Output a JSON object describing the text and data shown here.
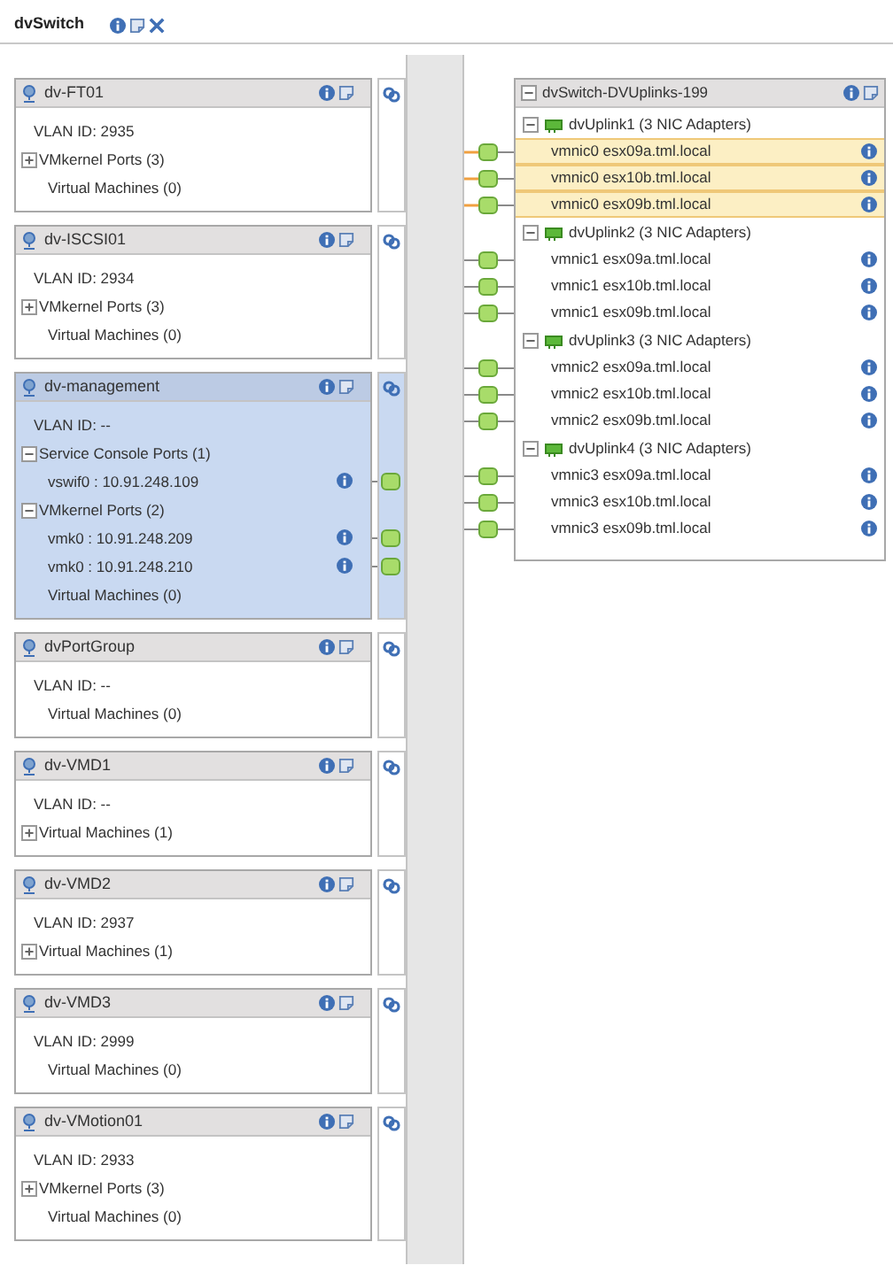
{
  "header": {
    "title": "dvSwitch"
  },
  "port_groups": [
    {
      "name": "dv-FT01",
      "selected": false,
      "lines": [
        {
          "kind": "text",
          "text": "VLAN ID: 2935"
        },
        {
          "kind": "group",
          "text": "VMkernel Ports (3)",
          "expanded": false
        },
        {
          "kind": "item",
          "text": "Virtual Machines (0)"
        }
      ]
    },
    {
      "name": "dv-ISCSI01",
      "selected": false,
      "lines": [
        {
          "kind": "text",
          "text": "VLAN ID: 2934"
        },
        {
          "kind": "group",
          "text": "VMkernel Ports (3)",
          "expanded": false
        },
        {
          "kind": "item",
          "text": "Virtual Machines (0)"
        }
      ]
    },
    {
      "name": "dv-management",
      "selected": true,
      "lines": [
        {
          "kind": "text",
          "text": "VLAN ID: --"
        },
        {
          "kind": "group",
          "text": "Service Console Ports (1)",
          "expanded": true
        },
        {
          "kind": "port",
          "text": "vswif0 : 10.91.248.109"
        },
        {
          "kind": "group",
          "text": "VMkernel Ports (2)",
          "expanded": true
        },
        {
          "kind": "port",
          "text": "vmk0 : 10.91.248.209"
        },
        {
          "kind": "port",
          "text": "vmk0 : 10.91.248.210"
        },
        {
          "kind": "item",
          "text": "Virtual Machines (0)"
        }
      ]
    },
    {
      "name": "dvPortGroup",
      "selected": false,
      "lines": [
        {
          "kind": "text",
          "text": "VLAN ID: --"
        },
        {
          "kind": "item",
          "text": "Virtual Machines (0)"
        }
      ]
    },
    {
      "name": "dv-VMD1",
      "selected": false,
      "lines": [
        {
          "kind": "text",
          "text": "VLAN ID: --"
        },
        {
          "kind": "group",
          "text": "Virtual Machines (1)",
          "expanded": false
        }
      ]
    },
    {
      "name": "dv-VMD2",
      "selected": false,
      "lines": [
        {
          "kind": "text",
          "text": "VLAN ID: 2937"
        },
        {
          "kind": "group",
          "text": "Virtual Machines (1)",
          "expanded": false
        }
      ]
    },
    {
      "name": "dv-VMD3",
      "selected": false,
      "lines": [
        {
          "kind": "text",
          "text": "VLAN ID: 2999"
        },
        {
          "kind": "item",
          "text": "Virtual Machines (0)"
        }
      ]
    },
    {
      "name": "dv-VMotion01",
      "selected": false,
      "lines": [
        {
          "kind": "text",
          "text": "VLAN ID: 2933"
        },
        {
          "kind": "group",
          "text": "VMkernel Ports (3)",
          "expanded": false
        },
        {
          "kind": "item",
          "text": "Virtual Machines (0)"
        }
      ]
    }
  ],
  "uplinks": {
    "title": "dvSwitch-DVUplinks-199",
    "expanded": true,
    "groups": [
      {
        "name": "dvUplink1 (3 NIC Adapters)",
        "expanded": true,
        "nics": [
          {
            "name": "vmnic0 esx09a.tml.local",
            "selected": true
          },
          {
            "name": "vmnic0 esx10b.tml.local",
            "selected": true
          },
          {
            "name": "vmnic0 esx09b.tml.local",
            "selected": true
          }
        ]
      },
      {
        "name": "dvUplink2 (3 NIC Adapters)",
        "expanded": true,
        "nics": [
          {
            "name": "vmnic1 esx09a.tml.local",
            "selected": false
          },
          {
            "name": "vmnic1 esx10b.tml.local",
            "selected": false
          },
          {
            "name": "vmnic1 esx09b.tml.local",
            "selected": false
          }
        ]
      },
      {
        "name": "dvUplink3 (3 NIC Adapters)",
        "expanded": true,
        "nics": [
          {
            "name": "vmnic2 esx09a.tml.local",
            "selected": false
          },
          {
            "name": "vmnic2 esx10b.tml.local",
            "selected": false
          },
          {
            "name": "vmnic2 esx09b.tml.local",
            "selected": false
          }
        ]
      },
      {
        "name": "dvUplink4 (3 NIC Adapters)",
        "expanded": true,
        "nics": [
          {
            "name": "vmnic3 esx09a.tml.local",
            "selected": false
          },
          {
            "name": "vmnic3 esx10b.tml.local",
            "selected": false
          },
          {
            "name": "vmnic3 esx09b.tml.local",
            "selected": false
          }
        ]
      }
    ]
  }
}
